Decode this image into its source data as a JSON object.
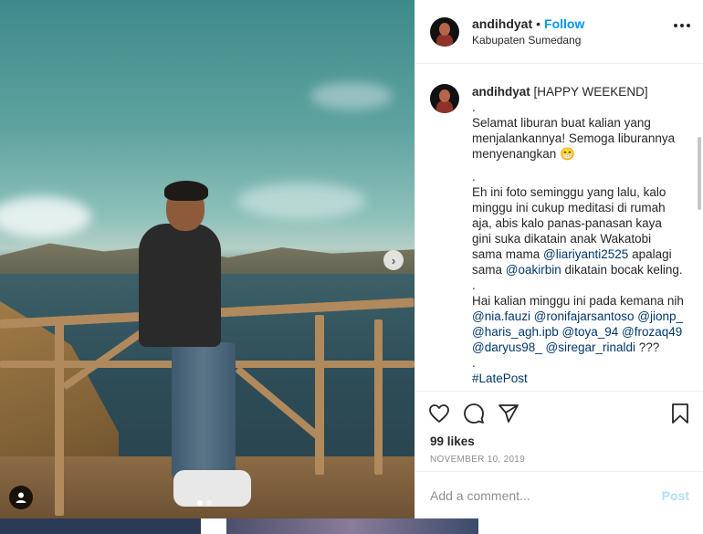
{
  "header": {
    "username": "andihdyat",
    "separator": "•",
    "follow_label": "Follow",
    "location": "Kabupaten Sumedang"
  },
  "caption": {
    "username": "andihdyat",
    "paragraphs": [
      {
        "text": "[HAPPY WEEKEND]"
      },
      {
        "text": "."
      },
      {
        "text": "Selamat liburan buat kalian yang menjalankannya! Semoga liburannya menyenangkan 😁"
      },
      {
        "text": "."
      },
      {
        "text": "Eh ini foto seminggu yang lalu, kalo minggu ini cukup meditasi di rumah aja, abis kalo panas-panasan kaya gini suka dikatain anak Wakatobi sama mama"
      }
    ],
    "mention1": "@liariyanti2525",
    "mid1": "apalagi sama",
    "mention2": "@oakirbin",
    "mid2": "dikatain bocak keling.",
    "dot3": ".",
    "line3": "Hai kalian minggu ini pada kemana nih",
    "mentions_list": [
      "@nia.fauzi",
      "@ronifajarsantoso",
      "@jionp_",
      "@haris_agh.ipb",
      "@toya_94",
      "@frozaq49",
      "@daryus98_",
      "@siregar_rinaldi"
    ],
    "tail": "???",
    "dot4": ".",
    "hashtag": "#LatePost"
  },
  "stats": {
    "likes": "99 likes",
    "date": "NOVEMBER 10, 2019"
  },
  "comment": {
    "placeholder": "Add a comment...",
    "post_label": "Post"
  },
  "colors": {
    "accent": "#0095f6",
    "mention": "#00376b",
    "muted": "#8e8e8e",
    "post_disabled": "#b2dffc"
  },
  "icons": {
    "heart": "heart-icon",
    "comment": "comment-icon",
    "share": "share-icon",
    "bookmark": "bookmark-icon",
    "more": "more-options-icon",
    "next": "chevron-right-icon",
    "tag": "user-tag-icon"
  },
  "carousel": {
    "total": 2,
    "current": 1
  }
}
